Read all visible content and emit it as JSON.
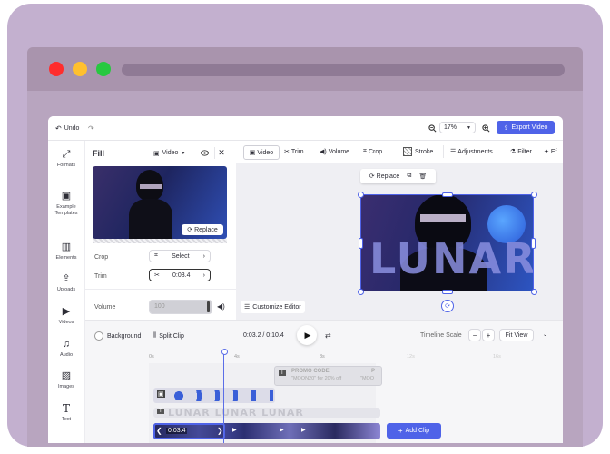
{
  "colors": {
    "frame": "#c3b0cf",
    "window_bar": "#a994ad",
    "accent": "#4f63e8",
    "playhead": "#5b6ee8",
    "mac_close": "#ff2d2d",
    "mac_minimize": "#ffc02e",
    "mac_maximize": "#28c840"
  },
  "topbar": {
    "undo_label": "Undo",
    "zoom_level": "17%",
    "export_label": "Export Video"
  },
  "sidebar": {
    "items": [
      {
        "label": "Formats",
        "icon": "formats-icon"
      },
      {
        "label": "Example Templates",
        "icon": "templates-icon"
      },
      {
        "label": "Elements",
        "icon": "elements-icon"
      },
      {
        "label": "Uploads",
        "icon": "upload-icon"
      },
      {
        "label": "Videos",
        "icon": "video-icon"
      },
      {
        "label": "Audio",
        "icon": "music-icon"
      },
      {
        "label": "Images",
        "icon": "image-icon"
      },
      {
        "label": "Text",
        "icon": "text-icon"
      }
    ]
  },
  "panel": {
    "title": "Fill",
    "type_label": "Video",
    "replace_label": "Replace",
    "crop_label": "Crop",
    "crop_value": "Select",
    "trim_label": "Trim",
    "trim_value": "0:03.4",
    "volume_label": "Volume",
    "volume_value": "100",
    "volume_level": 1.0
  },
  "canvas_toolbar": {
    "tabs": [
      "Video",
      "Trim",
      "Volume",
      "Crop",
      "Stroke",
      "Adjustments",
      "Filter",
      "Ef"
    ],
    "active_tab": "Video"
  },
  "canvas": {
    "replace_label": "Replace",
    "customize_label": "Customize Editor",
    "video_text": "LUNAR"
  },
  "timeline": {
    "background_label": "Background",
    "split_label": "Split Clip",
    "time_display": "0:03.2 / 0:10.4",
    "scale_label": "Timeline Scale",
    "fit_view_label": "Fit View",
    "ticks": [
      "0s",
      "4s",
      "8s",
      "12s",
      "16s",
      "20s"
    ],
    "text_clip_title": "PROMO CODE",
    "text_clip_sub": "\"MOON20\" for 20% off",
    "text_clip_title2": "P",
    "text_clip_sub2": "\"MOO",
    "text_track_text": "LUNAR LUNAR LUNAR",
    "video_clip_time": "0:03.4",
    "add_clip_label": "Add Clip"
  }
}
